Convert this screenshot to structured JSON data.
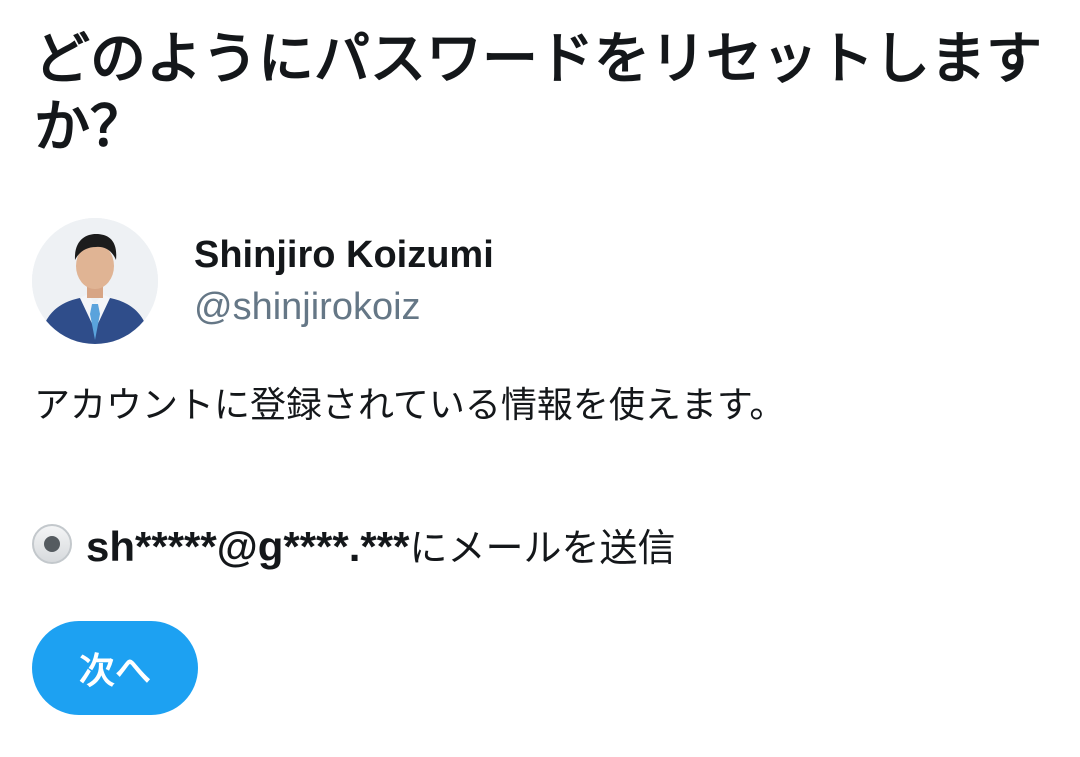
{
  "heading": {
    "title": "どのようにパスワードをリセットしますか？"
  },
  "account": {
    "display_name": "Shinjiro Koizumi",
    "handle": "@shinjirokoiz",
    "avatar_icon": "profile-photo"
  },
  "description": "アカウントに登録されている情報を使えます。",
  "reset_option": {
    "email_masked": "sh*****@g****.***",
    "suffix": "にメールを送信",
    "selected": true
  },
  "actions": {
    "next_label": "次へ"
  },
  "colors": {
    "accent": "#1da1f2",
    "text_primary": "#14171a",
    "text_secondary": "#657786"
  }
}
